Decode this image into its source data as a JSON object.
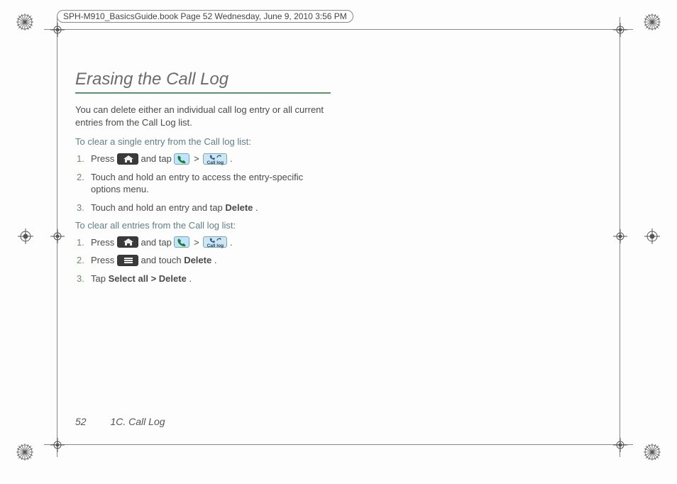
{
  "header": {
    "filepill": "SPH-M910_BasicsGuide.book  Page 52  Wednesday, June 9, 2010  3:56 PM"
  },
  "title": "Erasing the Call Log",
  "intro": "You can delete either an individual call log entry or all current entries from the Call Log list.",
  "section1": {
    "heading": "To clear a single entry from the Call log list:",
    "steps": {
      "s1_num": "1.",
      "s1a": "Press ",
      "s1b": " and tap ",
      "s1c": " > ",
      "s1d": ".",
      "s2_num": "2.",
      "s2": "Touch and hold an entry to access the entry-specific options menu.",
      "s3_num": "3.",
      "s3a": "Touch and hold an entry and tap ",
      "s3_delete": "Delete",
      "s3b": "."
    }
  },
  "section2": {
    "heading": "To clear all entries from the Call log list:",
    "steps": {
      "s1_num": "1.",
      "s1a": "Press ",
      "s1b": " and tap ",
      "s1c": " > ",
      "s1d": ".",
      "s2_num": "2.",
      "s2a": "Press ",
      "s2b": " and touch ",
      "s2_delete": "Delete",
      "s2c": ".",
      "s3_num": "3.",
      "s3a": "Tap ",
      "s3_selectall": "Select all",
      "s3_gt": " > ",
      "s3_delete": "Delete",
      "s3b": "."
    }
  },
  "icons": {
    "home": "home-button-icon",
    "phone": "phone-icon",
    "calllog_label": "Call log",
    "menu": "menu-button-icon"
  },
  "footer": {
    "pagenum": "52",
    "section": "1C. Call Log"
  }
}
